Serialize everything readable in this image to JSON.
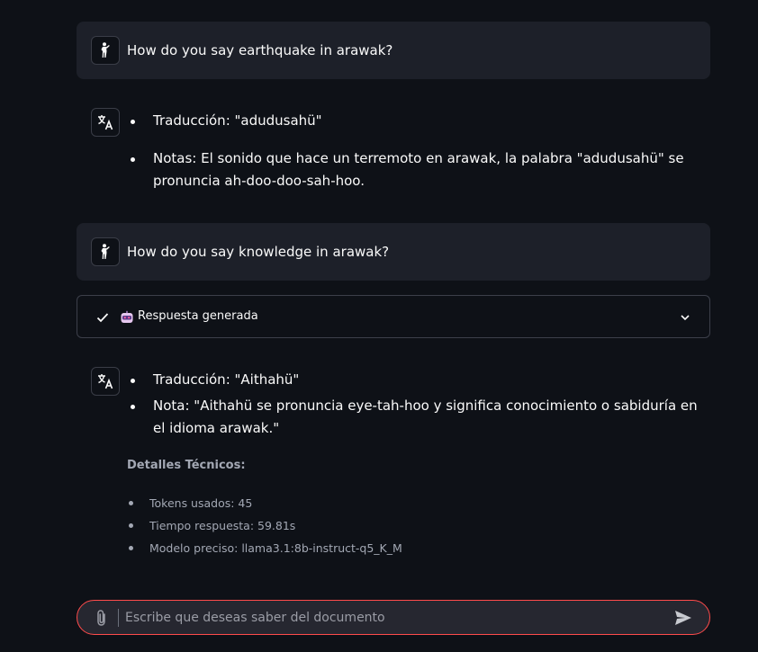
{
  "messages": [
    {
      "role": "user",
      "avatar_icon": "person-waving-icon",
      "text": "How do you say earthquake in arawak?"
    },
    {
      "role": "assistant",
      "avatar_icon": "translate-icon",
      "bullets": [
        "Traducción: \"adudusahü\"",
        "Notas: El sonido que hace un terremoto en arawak, la palabra \"adudusahü\" se pronuncia ah-doo-doo-sah-hoo."
      ]
    },
    {
      "role": "user",
      "avatar_icon": "person-waving-icon",
      "text": "How do you say knowledge in arawak?"
    },
    {
      "role": "assistant",
      "avatar_icon": "translate-icon",
      "bullets": [
        "Traducción: \"Aithahü\"",
        "Nota: \"Aithahü se pronuncia eye-tah-hoo y significa conocimiento o sabiduría en el idioma arawak.\""
      ]
    }
  ],
  "status_expander": {
    "label": "Respuesta generada",
    "state_icon": "checkmark-icon",
    "emoji_icon": "robot-emoji-icon",
    "toggle_icon": "chevron-down-icon"
  },
  "technical_details": {
    "title": "Detalles Técnicos:",
    "items": [
      "Tokens usados: 45",
      "Tiempo respuesta: 59.81s",
      "Modelo preciso: llama3.1:8b-instruct-q5_K_M"
    ]
  },
  "chat_input": {
    "value": "",
    "placeholder": "Escribe que deseas saber del documento",
    "attach_icon": "paperclip-icon",
    "send_icon": "send-icon"
  },
  "colors": {
    "background": "#0e1117",
    "user_bubble": "#1d2029",
    "input_background": "#262730",
    "input_border": "#ff4b4b",
    "text": "#fafafa",
    "muted_text": "#a3a8b4"
  }
}
